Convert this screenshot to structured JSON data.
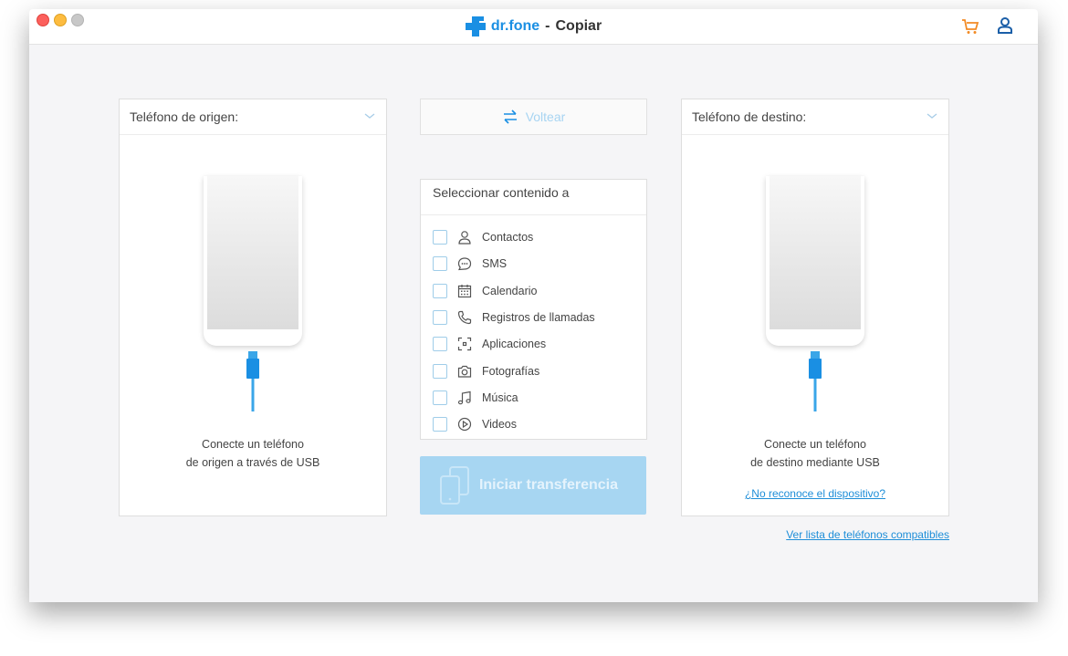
{
  "window": {
    "brand_logo": "dr.fone",
    "brand_separator": "-",
    "module": "Copiar",
    "accent_color": "#1a8fe3",
    "cart_color": "#f28a24",
    "icons": [
      "cart-icon",
      "user-icon"
    ]
  },
  "source": {
    "header": "Teléfono de origen:",
    "caption_line1": "Conecte un teléfono",
    "caption_line2": "de origen a través de USB"
  },
  "flip": {
    "label": "Voltear"
  },
  "content": {
    "header": "Seleccionar contenido a",
    "items": [
      {
        "label": "Contactos",
        "icon": "contact-icon"
      },
      {
        "label": "SMS",
        "icon": "sms-icon"
      },
      {
        "label": "Calendario",
        "icon": "calendar-icon"
      },
      {
        "label": "Registros de llamadas",
        "icon": "phone-icon"
      },
      {
        "label": "Aplicaciones",
        "icon": "apps-icon"
      },
      {
        "label": "Fotografías",
        "icon": "camera-icon"
      },
      {
        "label": "Música",
        "icon": "music-icon"
      },
      {
        "label": "Videos",
        "icon": "video-icon"
      }
    ]
  },
  "start": {
    "label": "Iniciar transferencia"
  },
  "destination": {
    "header": "Teléfono de destino:",
    "caption_line1": "Conecte un teléfono",
    "caption_line2": "de destino mediante USB",
    "help_link": "¿No reconoce el dispositivo?"
  },
  "footer": {
    "compat_link": "Ver lista de teléfonos compatibles"
  }
}
